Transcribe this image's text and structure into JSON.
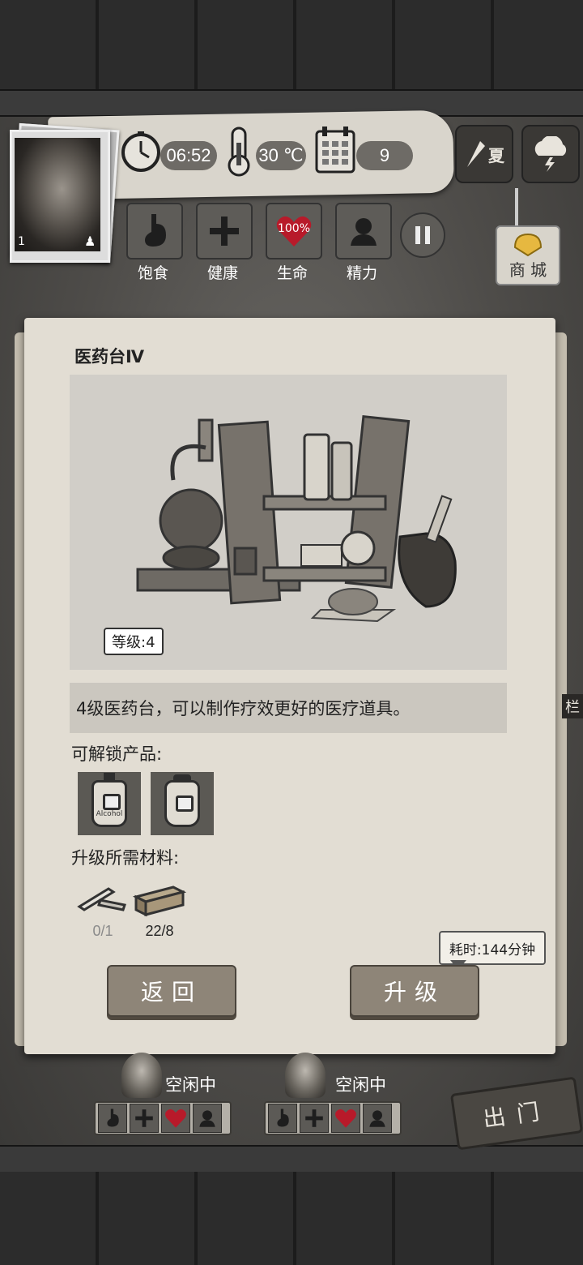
{
  "hud": {
    "time": "06:52",
    "temperature": "30 ℃",
    "day": "9",
    "season": "夏",
    "avatar_level": "1",
    "icons": {
      "clock": "clock-icon",
      "thermometer": "thermometer-icon",
      "calendar": "calendar-icon",
      "weather": "thunderstorm-icon"
    }
  },
  "status": [
    {
      "label": "饱食",
      "icon": "stomach-icon"
    },
    {
      "label": "健康",
      "icon": "health-cross-icon"
    },
    {
      "label": "生命",
      "icon": "heart-icon",
      "value": "100%"
    },
    {
      "label": "精力",
      "icon": "person-icon"
    }
  ],
  "shop": {
    "label": "商 城"
  },
  "panel": {
    "title": "医药台Ⅳ",
    "level_badge": "等级:4",
    "description": "4级医药台，可以制作疗效更好的医疗道具。",
    "unlock_label": "可解锁产品:",
    "unlock_items": [
      {
        "icon": "locked-alcohol-bottle-icon",
        "jar_label": "Alcohol"
      },
      {
        "icon": "locked-jar-icon"
      }
    ],
    "materials_label": "升级所需材料:",
    "materials": [
      {
        "icon": "metal-pipe-icon",
        "count": "0/1",
        "sufficient": false
      },
      {
        "icon": "wood-planks-icon",
        "count": "22/8",
        "sufficient": true
      }
    ],
    "tooltip": "耗时:144分钟",
    "back_button": "返回",
    "upgrade_button": "升级"
  },
  "survivors": [
    {
      "status": "空闲中"
    },
    {
      "status": "空闲中"
    }
  ],
  "side_label": "栏",
  "go_out_button": "出门",
  "colors": {
    "insufficient": "#8a8a8a",
    "sufficient": "#222222",
    "heart": "#b81a2a"
  }
}
